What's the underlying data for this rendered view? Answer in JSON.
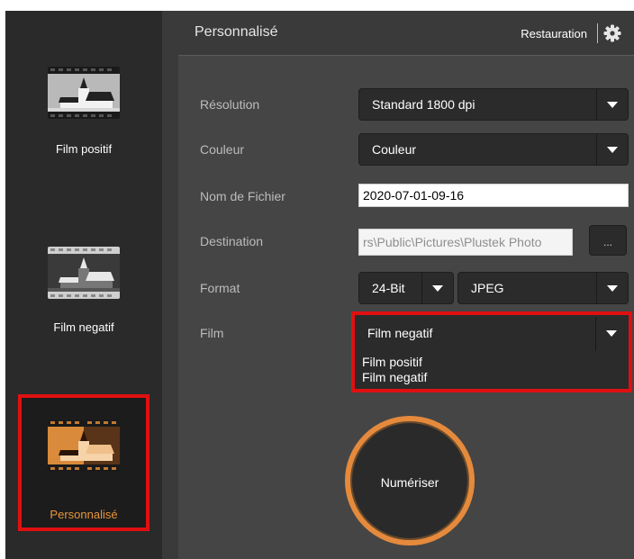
{
  "sidebar": {
    "items": [
      {
        "label": "Film positif"
      },
      {
        "label": "Film negatif"
      },
      {
        "label": "Personnalisé"
      }
    ]
  },
  "header": {
    "title": "Personnalisé",
    "restore_label": "Restauration",
    "settings_icon": "gear-icon"
  },
  "form": {
    "resolution": {
      "label": "Résolution",
      "value": "Standard 1800 dpi"
    },
    "color": {
      "label": "Couleur",
      "value": "Couleur"
    },
    "filename": {
      "label": "Nom de Fichier",
      "value": "2020-07-01-09-16"
    },
    "destination": {
      "label": "Destination",
      "value": "rs\\Public\\Pictures\\Plustek Photo",
      "browse_label": "..."
    },
    "format": {
      "label": "Format",
      "bits": "24-Bit",
      "type": "JPEG"
    },
    "film": {
      "label": "Film",
      "value": "Film negatif",
      "options": [
        "Film positif",
        "Film negatif"
      ]
    }
  },
  "scan_button": {
    "label": "Numériser"
  },
  "colors": {
    "accent": "#e8963a",
    "highlight": "#e01010"
  }
}
